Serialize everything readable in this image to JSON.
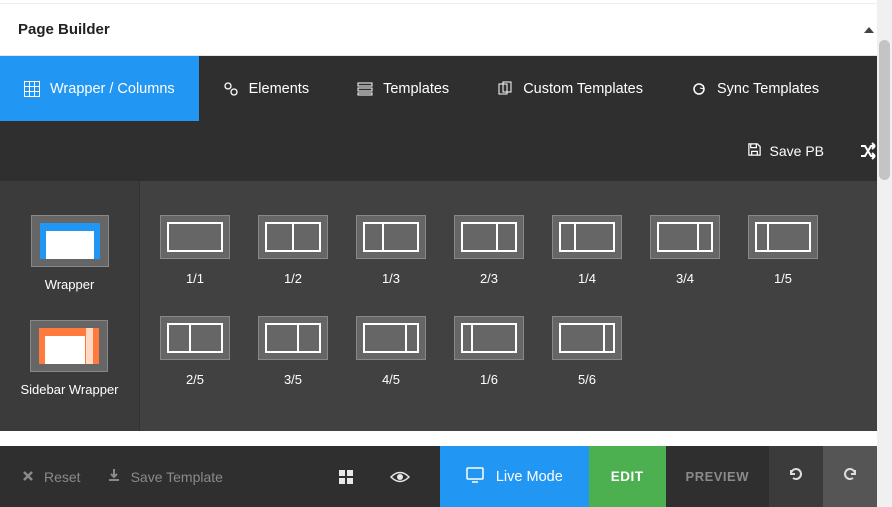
{
  "header": {
    "title": "Page Builder"
  },
  "tabs": [
    {
      "label": "Wrapper / Columns"
    },
    {
      "label": "Elements"
    },
    {
      "label": "Templates"
    },
    {
      "label": "Custom Templates"
    },
    {
      "label": "Sync Templates"
    }
  ],
  "savebar": {
    "save": "Save PB"
  },
  "wrappers": [
    {
      "label": "Wrapper"
    },
    {
      "label": "Sidebar Wrapper"
    }
  ],
  "columns": [
    {
      "label": "1/1",
      "split": [
        1
      ]
    },
    {
      "label": "1/2",
      "split": [
        1,
        1
      ]
    },
    {
      "label": "1/3",
      "split": [
        1,
        2
      ]
    },
    {
      "label": "2/3",
      "split": [
        2,
        1
      ]
    },
    {
      "label": "1/4",
      "split": [
        1,
        3
      ]
    },
    {
      "label": "3/4",
      "split": [
        3,
        1
      ]
    },
    {
      "label": "1/5",
      "split": [
        1,
        4
      ]
    },
    {
      "label": "2/5",
      "split": [
        2,
        3
      ]
    },
    {
      "label": "3/5",
      "split": [
        3,
        2
      ]
    },
    {
      "label": "4/5",
      "split": [
        4,
        1
      ]
    },
    {
      "label": "1/6",
      "split": [
        1,
        5
      ]
    },
    {
      "label": "5/6",
      "split": [
        5,
        1
      ]
    }
  ],
  "bottombar": {
    "reset": "Reset",
    "save_template": "Save Template",
    "live": "Live Mode",
    "edit": "EDIT",
    "preview": "PREVIEW"
  }
}
